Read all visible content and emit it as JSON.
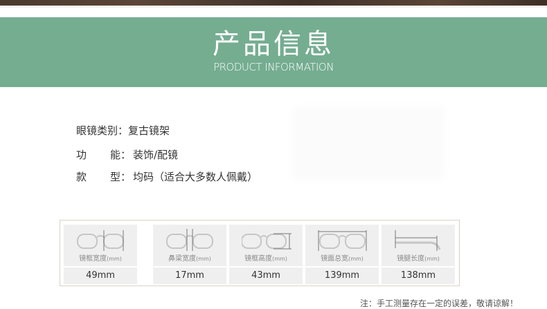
{
  "banner": {
    "title": "产品信息",
    "subtitle": "PRODUCT INFORMATION"
  },
  "info": {
    "rows": [
      {
        "label": "眼镜类别：",
        "value": "复古镜架"
      },
      {
        "label_a": "功",
        "label_b": "能：",
        "value": "装饰/配镜"
      },
      {
        "label_a": "款",
        "label_b": "型：",
        "value": "均码（适合大多数人佩戴）"
      }
    ]
  },
  "measurements": [
    {
      "name": "镜框宽度",
      "unit": "(mm)",
      "value": "49mm",
      "icon": "lens-width-icon"
    },
    {
      "name": "鼻梁宽度",
      "unit": "(mm)",
      "value": "17mm",
      "icon": "bridge-width-icon"
    },
    {
      "name": "镜框高度",
      "unit": "(mm)",
      "value": "43mm",
      "icon": "lens-height-icon"
    },
    {
      "name": "镜面总宽",
      "unit": "(mm)",
      "value": "139mm",
      "icon": "frame-total-width-icon"
    },
    {
      "name": "镜腿长度",
      "unit": "(mm)",
      "value": "138mm",
      "icon": "temple-length-icon"
    }
  ],
  "note": "注：手工测量存在一定的误差，敬请谅解！",
  "colors": {
    "banner": "#75ad91",
    "icon_stroke": "#c9c9c9"
  }
}
